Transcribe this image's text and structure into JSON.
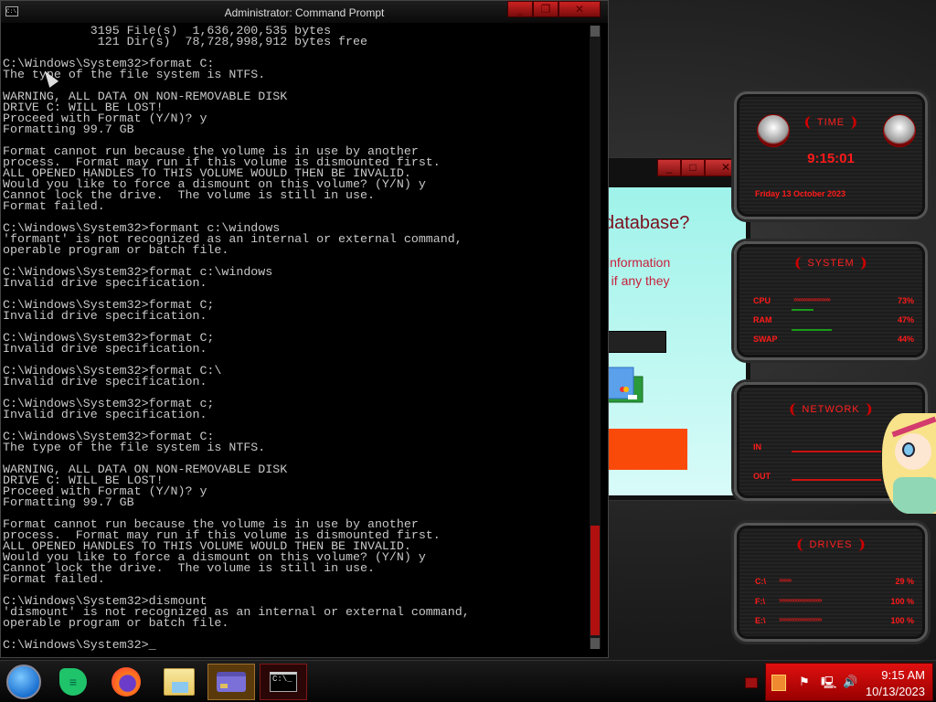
{
  "cmd_window": {
    "title": "Administrator: Command Prompt",
    "icon_label": "C:\\.",
    "lines": [
      "            3195 File(s)  1,636,200,535 bytes",
      "             121 Dir(s)  78,728,998,912 bytes free",
      "",
      "C:\\Windows\\System32>format C:",
      "The type of the file system is NTFS.",
      "",
      "WARNING, ALL DATA ON NON-REMOVABLE DISK",
      "DRIVE C: WILL BE LOST!",
      "Proceed with Format (Y/N)? y",
      "Formatting 99.7 GB",
      "",
      "Format cannot run because the volume is in use by another",
      "process.  Format may run if this volume is dismounted first.",
      "ALL OPENED HANDLES TO THIS VOLUME WOULD THEN BE INVALID.",
      "Would you like to force a dismount on this volume? (Y/N) y",
      "Cannot lock the drive.  The volume is still in use.",
      "Format failed.",
      "",
      "C:\\Windows\\System32>formant c:\\windows",
      "'formant' is not recognized as an internal or external command,",
      "operable program or batch file.",
      "",
      "C:\\Windows\\System32>format c:\\windows",
      "Invalid drive specification.",
      "",
      "C:\\Windows\\System32>format C;",
      "Invalid drive specification.",
      "",
      "C:\\Windows\\System32>format C;",
      "Invalid drive specification.",
      "",
      "C:\\Windows\\System32>format C:\\",
      "Invalid drive specification.",
      "",
      "C:\\Windows\\System32>format c;",
      "Invalid drive specification.",
      "",
      "C:\\Windows\\System32>format C:",
      "The type of the file system is NTFS.",
      "",
      "WARNING, ALL DATA ON NON-REMOVABLE DISK",
      "DRIVE C: WILL BE LOST!",
      "Proceed with Format (Y/N)? y",
      "Formatting 99.7 GB",
      "",
      "Format cannot run because the volume is in use by another",
      "process.  Format may run if this volume is dismounted first.",
      "ALL OPENED HANDLES TO THIS VOLUME WOULD THEN BE INVALID.",
      "Would you like to force a dismount on this volume? (Y/N) y",
      "Cannot lock the drive.  The volume is still in use.",
      "Format failed.",
      "",
      "C:\\Windows\\System32>dismount",
      "'dismount' is not recognized as an internal or external command,",
      "operable program or batch file.",
      "",
      "C:\\Windows\\System32>_"
    ]
  },
  "background_dialog": {
    "question": "database?",
    "line1": "information",
    "line2": "e if any they"
  },
  "widgets": {
    "time": {
      "title": "TIME",
      "clock": "9:15:01",
      "date": "Friday 13 October 2023"
    },
    "system": {
      "title": "SYSTEM",
      "rows": [
        {
          "label": "CPU",
          "value": "73%",
          "fraction": 0.73
        },
        {
          "label": "RAM",
          "value": "47%",
          "fraction": 0.47
        },
        {
          "label": "SWAP",
          "value": "44%",
          "fraction": 0.44
        }
      ]
    },
    "network": {
      "title": "NETWORK",
      "in_label": "IN",
      "out_label": "OUT"
    },
    "drives": {
      "title": "DRIVES",
      "rows": [
        {
          "label": "C:\\",
          "value": "29 %",
          "fraction": 0.29
        },
        {
          "label": "F:\\",
          "value": "100 %",
          "fraction": 1.0
        },
        {
          "label": "E:\\",
          "value": "100 %",
          "fraction": 1.0
        }
      ]
    }
  },
  "taskbar": {
    "items": [
      "start-orb",
      "chat-app",
      "firefox",
      "file-explorer",
      "card-app",
      "command-prompt"
    ],
    "cmd_icon_text": "C:\\_",
    "clock_time": "9:15 AM",
    "clock_date": "10/13/2023"
  },
  "colors": {
    "accent_red": "#ff1a1a",
    "dialog_cyan": "#9ff3ea",
    "orange_button": "#fa4a0a"
  }
}
